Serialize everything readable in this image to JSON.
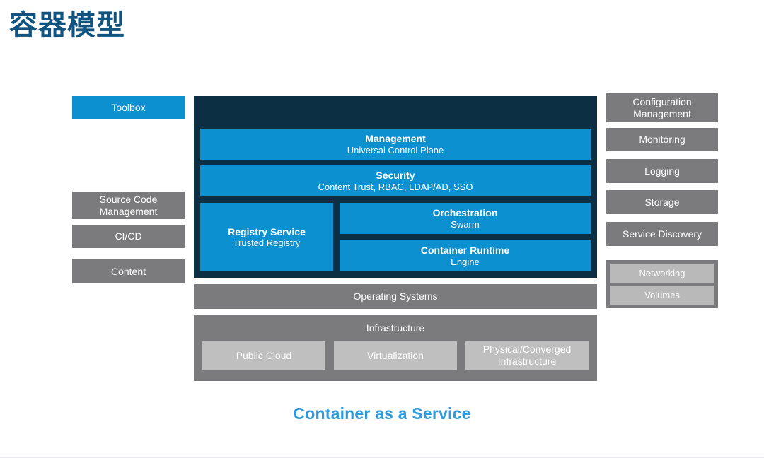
{
  "slide": {
    "title": "容器模型",
    "caption": "Container as a Service",
    "colors": {
      "title_blue": "#12537f",
      "accent_blue": "#0d90d0",
      "caption_blue": "#2e9bde",
      "dark_navy": "#0c2f44",
      "gray": "#7b7b7d",
      "light_gray": "#bfbfbf"
    }
  },
  "left_sidebar": {
    "items": [
      {
        "label": "Toolbox",
        "style": "blue"
      },
      {
        "label": "Source Code Management",
        "style": "gray"
      },
      {
        "label": "CI/CD",
        "style": "gray"
      },
      {
        "label": "Content",
        "style": "gray"
      }
    ]
  },
  "right_sidebar": {
    "items": [
      {
        "label": "Configuration Management"
      },
      {
        "label": "Monitoring"
      },
      {
        "label": "Logging"
      },
      {
        "label": "Storage"
      },
      {
        "label": "Service Discovery"
      }
    ],
    "group": {
      "items": [
        {
          "label": "Networking"
        },
        {
          "label": "Volumes"
        }
      ]
    }
  },
  "stack": {
    "management": {
      "title": "Management",
      "subtitle": "Universal Control Plane"
    },
    "security": {
      "title": "Security",
      "subtitle": "Content Trust, RBAC, LDAP/AD, SSO"
    },
    "registry": {
      "title": "Registry Service",
      "subtitle": "Trusted Registry"
    },
    "orchestration": {
      "title": "Orchestration",
      "subtitle": "Swarm"
    },
    "runtime": {
      "title": "Container Runtime",
      "subtitle": "Engine"
    },
    "operating_systems": {
      "label": "Operating Systems"
    },
    "infrastructure": {
      "label": "Infrastructure",
      "items": [
        {
          "label": "Public Cloud"
        },
        {
          "label": "Virtualization"
        },
        {
          "label": "Physical/Converged Infrastructure"
        }
      ]
    }
  }
}
